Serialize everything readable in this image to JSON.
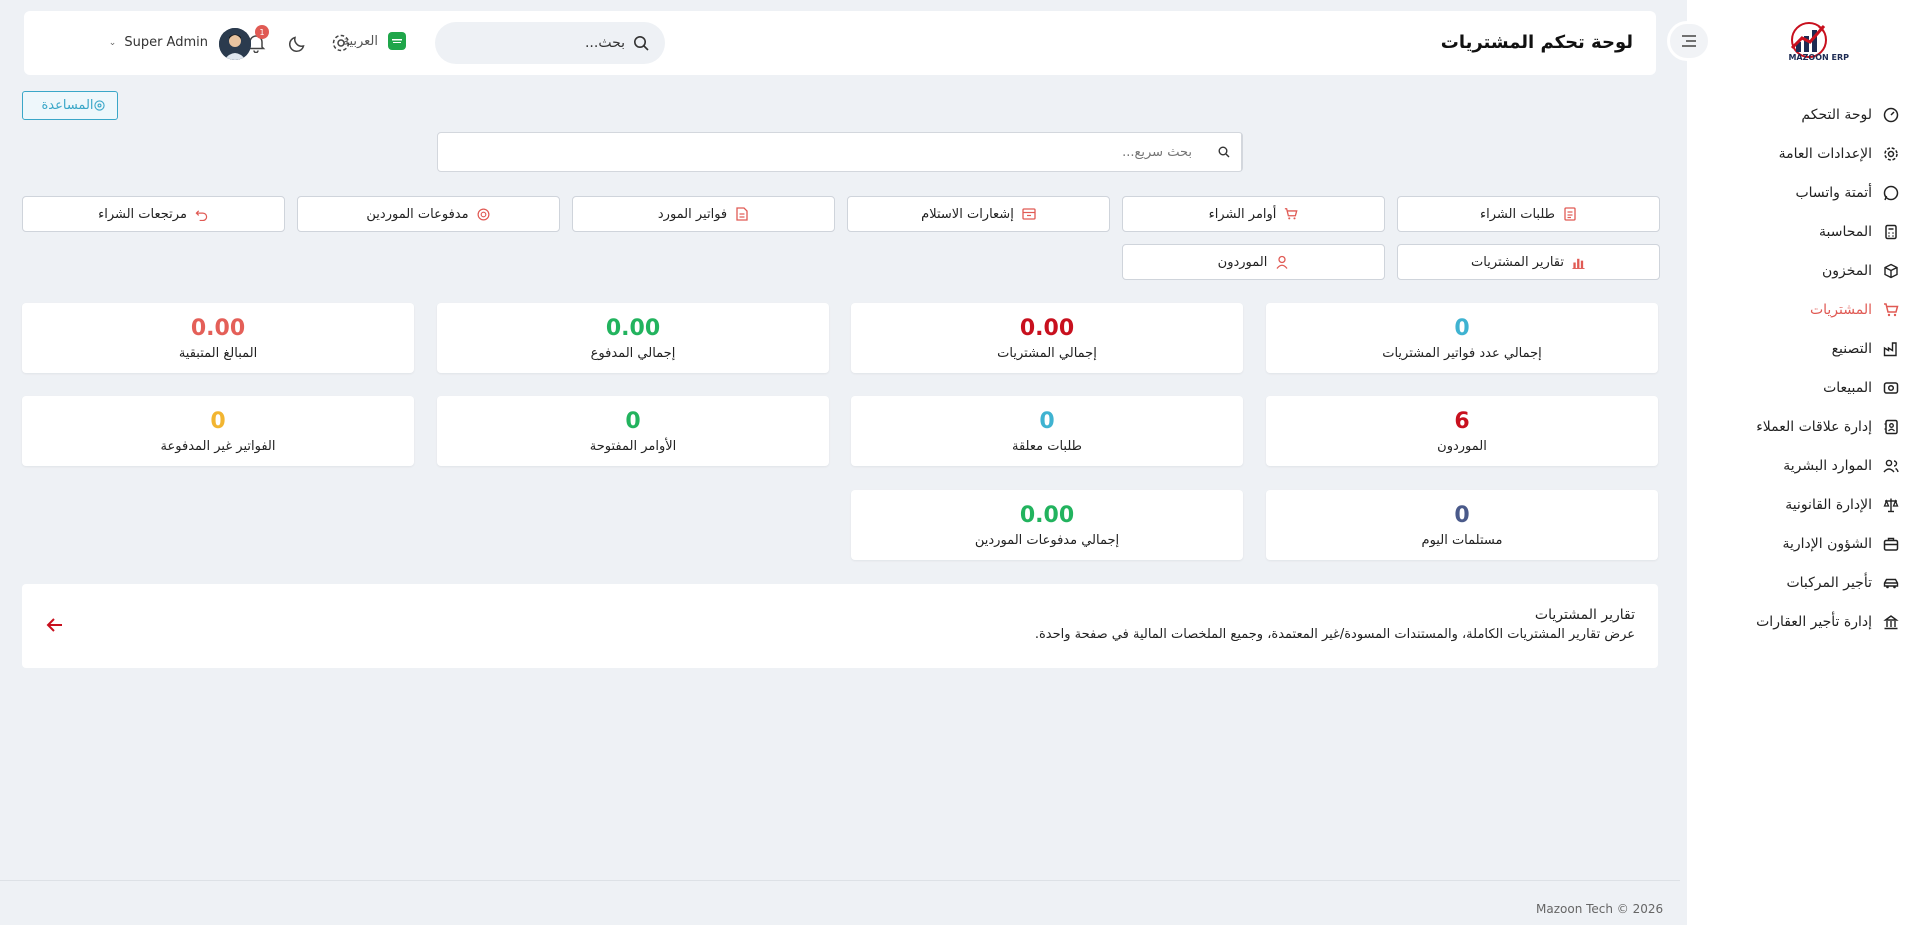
{
  "brand": {
    "logo_text": "MAZOON ERP"
  },
  "sidebar": {
    "items": [
      {
        "label": "لوحة التحكم",
        "icon": "dashboard-icon"
      },
      {
        "label": "الإعدادات العامة",
        "icon": "gear-icon"
      },
      {
        "label": "أتمتة واتساب",
        "icon": "whatsapp-icon"
      },
      {
        "label": "المحاسبة",
        "icon": "calculator-icon"
      },
      {
        "label": "المخزون",
        "icon": "box-icon"
      },
      {
        "label": "المشتريات",
        "icon": "cart-icon",
        "active": true
      },
      {
        "label": "التصنيع",
        "icon": "factory-icon"
      },
      {
        "label": "المبيعات",
        "icon": "sales-icon"
      },
      {
        "label": "إدارة علاقات العملاء",
        "icon": "contacts-icon"
      },
      {
        "label": "الموارد البشرية",
        "icon": "users-icon"
      },
      {
        "label": "الإدارة القانونية",
        "icon": "scales-icon"
      },
      {
        "label": "الشؤون الإدارية",
        "icon": "briefcase-icon"
      },
      {
        "label": "تأجير المركبات",
        "icon": "car-icon"
      },
      {
        "label": "إدارة تأجير العقارات",
        "icon": "building-icon"
      }
    ],
    "active_color": "#e05a54"
  },
  "header": {
    "title": "لوحة تحكم المشتريات",
    "search_value": "بحث...",
    "language": "العربية",
    "notification_count": "1",
    "user_name": "Super Admin"
  },
  "help": {
    "label": "المساعدة"
  },
  "quick_search": {
    "placeholder": "بحث سريع..."
  },
  "links": [
    {
      "label": "طلبات الشراء",
      "icon": "list-icon"
    },
    {
      "label": "أوامر الشراء",
      "icon": "cart-icon"
    },
    {
      "label": "إشعارات الاستلام",
      "icon": "inbox-icon"
    },
    {
      "label": "فواتير المورد",
      "icon": "document-icon"
    },
    {
      "label": "مدفوعات الموردين",
      "icon": "coin-icon"
    },
    {
      "label": "مرتجعات الشراء",
      "icon": "undo-icon"
    },
    {
      "label": "تقارير المشتريات",
      "icon": "bar-chart-icon"
    },
    {
      "label": "الموردون",
      "icon": "user-icon"
    }
  ],
  "stats": [
    {
      "value": "0",
      "label": "إجمالي عدد فواتير المشتريات",
      "color": "#3fb3d1"
    },
    {
      "value": "0.00",
      "label": "إجمالي المشتريات",
      "color": "#c8101e"
    },
    {
      "value": "0.00",
      "label": "إجمالي المدفوع",
      "color": "#22b35e"
    },
    {
      "value": "0.00",
      "label": "المبالغ المتبقية",
      "color": "#e45f58"
    },
    {
      "value": "6",
      "label": "الموردون",
      "color": "#c8101e"
    },
    {
      "value": "0",
      "label": "طلبات معلقة",
      "color": "#3fb3d1"
    },
    {
      "value": "0",
      "label": "الأوامر المفتوحة",
      "color": "#22b35e"
    },
    {
      "value": "0",
      "label": "الفواتير غير المدفوعة",
      "color": "#f2b531"
    },
    {
      "value": "0",
      "label": "مستلمات اليوم",
      "color": "#4a5a8a"
    },
    {
      "value": "0.00",
      "label": "إجمالي مدفوعات الموردين",
      "color": "#22b35e"
    }
  ],
  "report": {
    "title": "تقارير المشتريات",
    "description": "عرض تقارير المشتريات الكاملة، والمستندات المسودة/غير المعتمدة، وجميع الملخصات المالية في صفحة واحدة."
  },
  "footer": {
    "text": "Mazoon Tech © 2026"
  }
}
